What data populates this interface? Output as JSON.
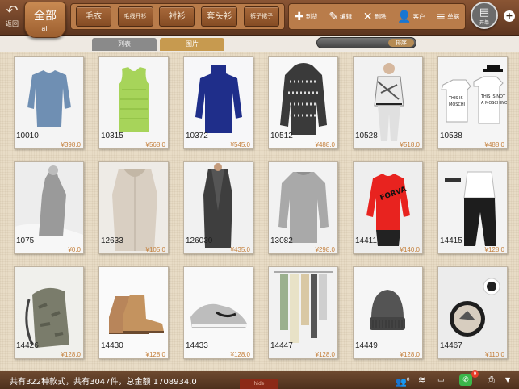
{
  "toolbar": {
    "back_label": "返回",
    "all_main": "全部",
    "all_sub": "all",
    "categories": [
      "毛衣",
      "毛线开衫",
      "衬衫",
      "套头衫",
      "裤子裙子"
    ],
    "actions": [
      {
        "label": "到货",
        "icon": "plus-icon"
      },
      {
        "label": "编辑",
        "icon": "pencil-icon"
      },
      {
        "label": "删除",
        "icon": "delete-icon"
      },
      {
        "label": "客户",
        "icon": "user-icon"
      },
      {
        "label": "单据",
        "icon": "stack-icon"
      }
    ],
    "round_label": "开单"
  },
  "view_tabs": {
    "list": "列表",
    "pictures": "图片"
  },
  "slider_label": "排序",
  "products": [
    {
      "code": "10010",
      "price": "¥398.0",
      "thumb": "sweater-blue"
    },
    {
      "code": "10315",
      "price": "¥568.0",
      "thumb": "vest-green"
    },
    {
      "code": "10372",
      "price": "¥545.0",
      "thumb": "sweater-navy"
    },
    {
      "code": "10512",
      "price": "¥488.0",
      "thumb": "hoodie-pattern"
    },
    {
      "code": "10528",
      "price": "¥518.0",
      "thumb": "person-print"
    },
    {
      "code": "10538",
      "price": "¥488.0",
      "thumb": "tees-text"
    },
    {
      "code": "1075",
      "price": "¥0.0",
      "thumb": "dress-gray"
    },
    {
      "code": "12633",
      "price": "¥105.0",
      "thumb": "coat-beige"
    },
    {
      "code": "126030",
      "price": "¥435.0",
      "thumb": "coat-charcoal"
    },
    {
      "code": "13082",
      "price": "¥298.0",
      "thumb": "sweater-gray"
    },
    {
      "code": "14411",
      "price": "¥140.0",
      "thumb": "sweater-red"
    },
    {
      "code": "14415",
      "price": "¥128.0",
      "thumb": "pants-black"
    },
    {
      "code": "14426",
      "price": "¥128.0",
      "thumb": "backpack-camo"
    },
    {
      "code": "14430",
      "price": "¥128.0",
      "thumb": "boots-tan"
    },
    {
      "code": "14433",
      "price": "¥128.0",
      "thumb": "sneaker-gray"
    },
    {
      "code": "14447",
      "price": "¥128.0",
      "thumb": "scarves"
    },
    {
      "code": "14449",
      "price": "¥128.0",
      "thumb": "beanie"
    },
    {
      "code": "14467",
      "price": "¥110.0",
      "thumb": "tray-cup"
    }
  ],
  "status": {
    "summary": "共有322种款式，共有3047件，总金额  1708934.0",
    "hide_label": "hide",
    "user_count": "0",
    "wechat_badge": "9"
  }
}
